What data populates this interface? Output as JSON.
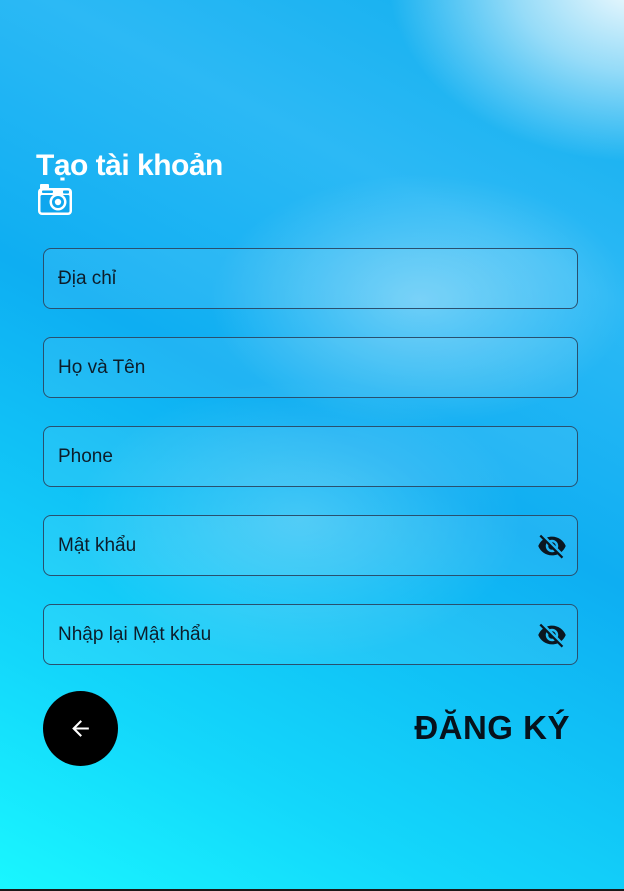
{
  "title": "Tạo tài khoản",
  "icons": {
    "camera": "camera-icon",
    "visibility_off": "eye-off-icon",
    "back_arrow": "arrow-left-icon"
  },
  "fields": {
    "address": {
      "placeholder": "Địa chỉ",
      "value": ""
    },
    "full_name": {
      "placeholder": "Họ và Tên",
      "value": ""
    },
    "phone": {
      "placeholder": "Phone",
      "value": ""
    },
    "password": {
      "placeholder": "Mật khẩu",
      "value": ""
    },
    "confirm_password": {
      "placeholder": "Nhập lại Mật khẩu",
      "value": ""
    }
  },
  "buttons": {
    "register_label": "ĐĂNG KÝ"
  },
  "colors": {
    "title_text": "#ffffff",
    "field_border": "#29506f",
    "back_button_bg": "#000000",
    "register_text": "#06121c"
  }
}
